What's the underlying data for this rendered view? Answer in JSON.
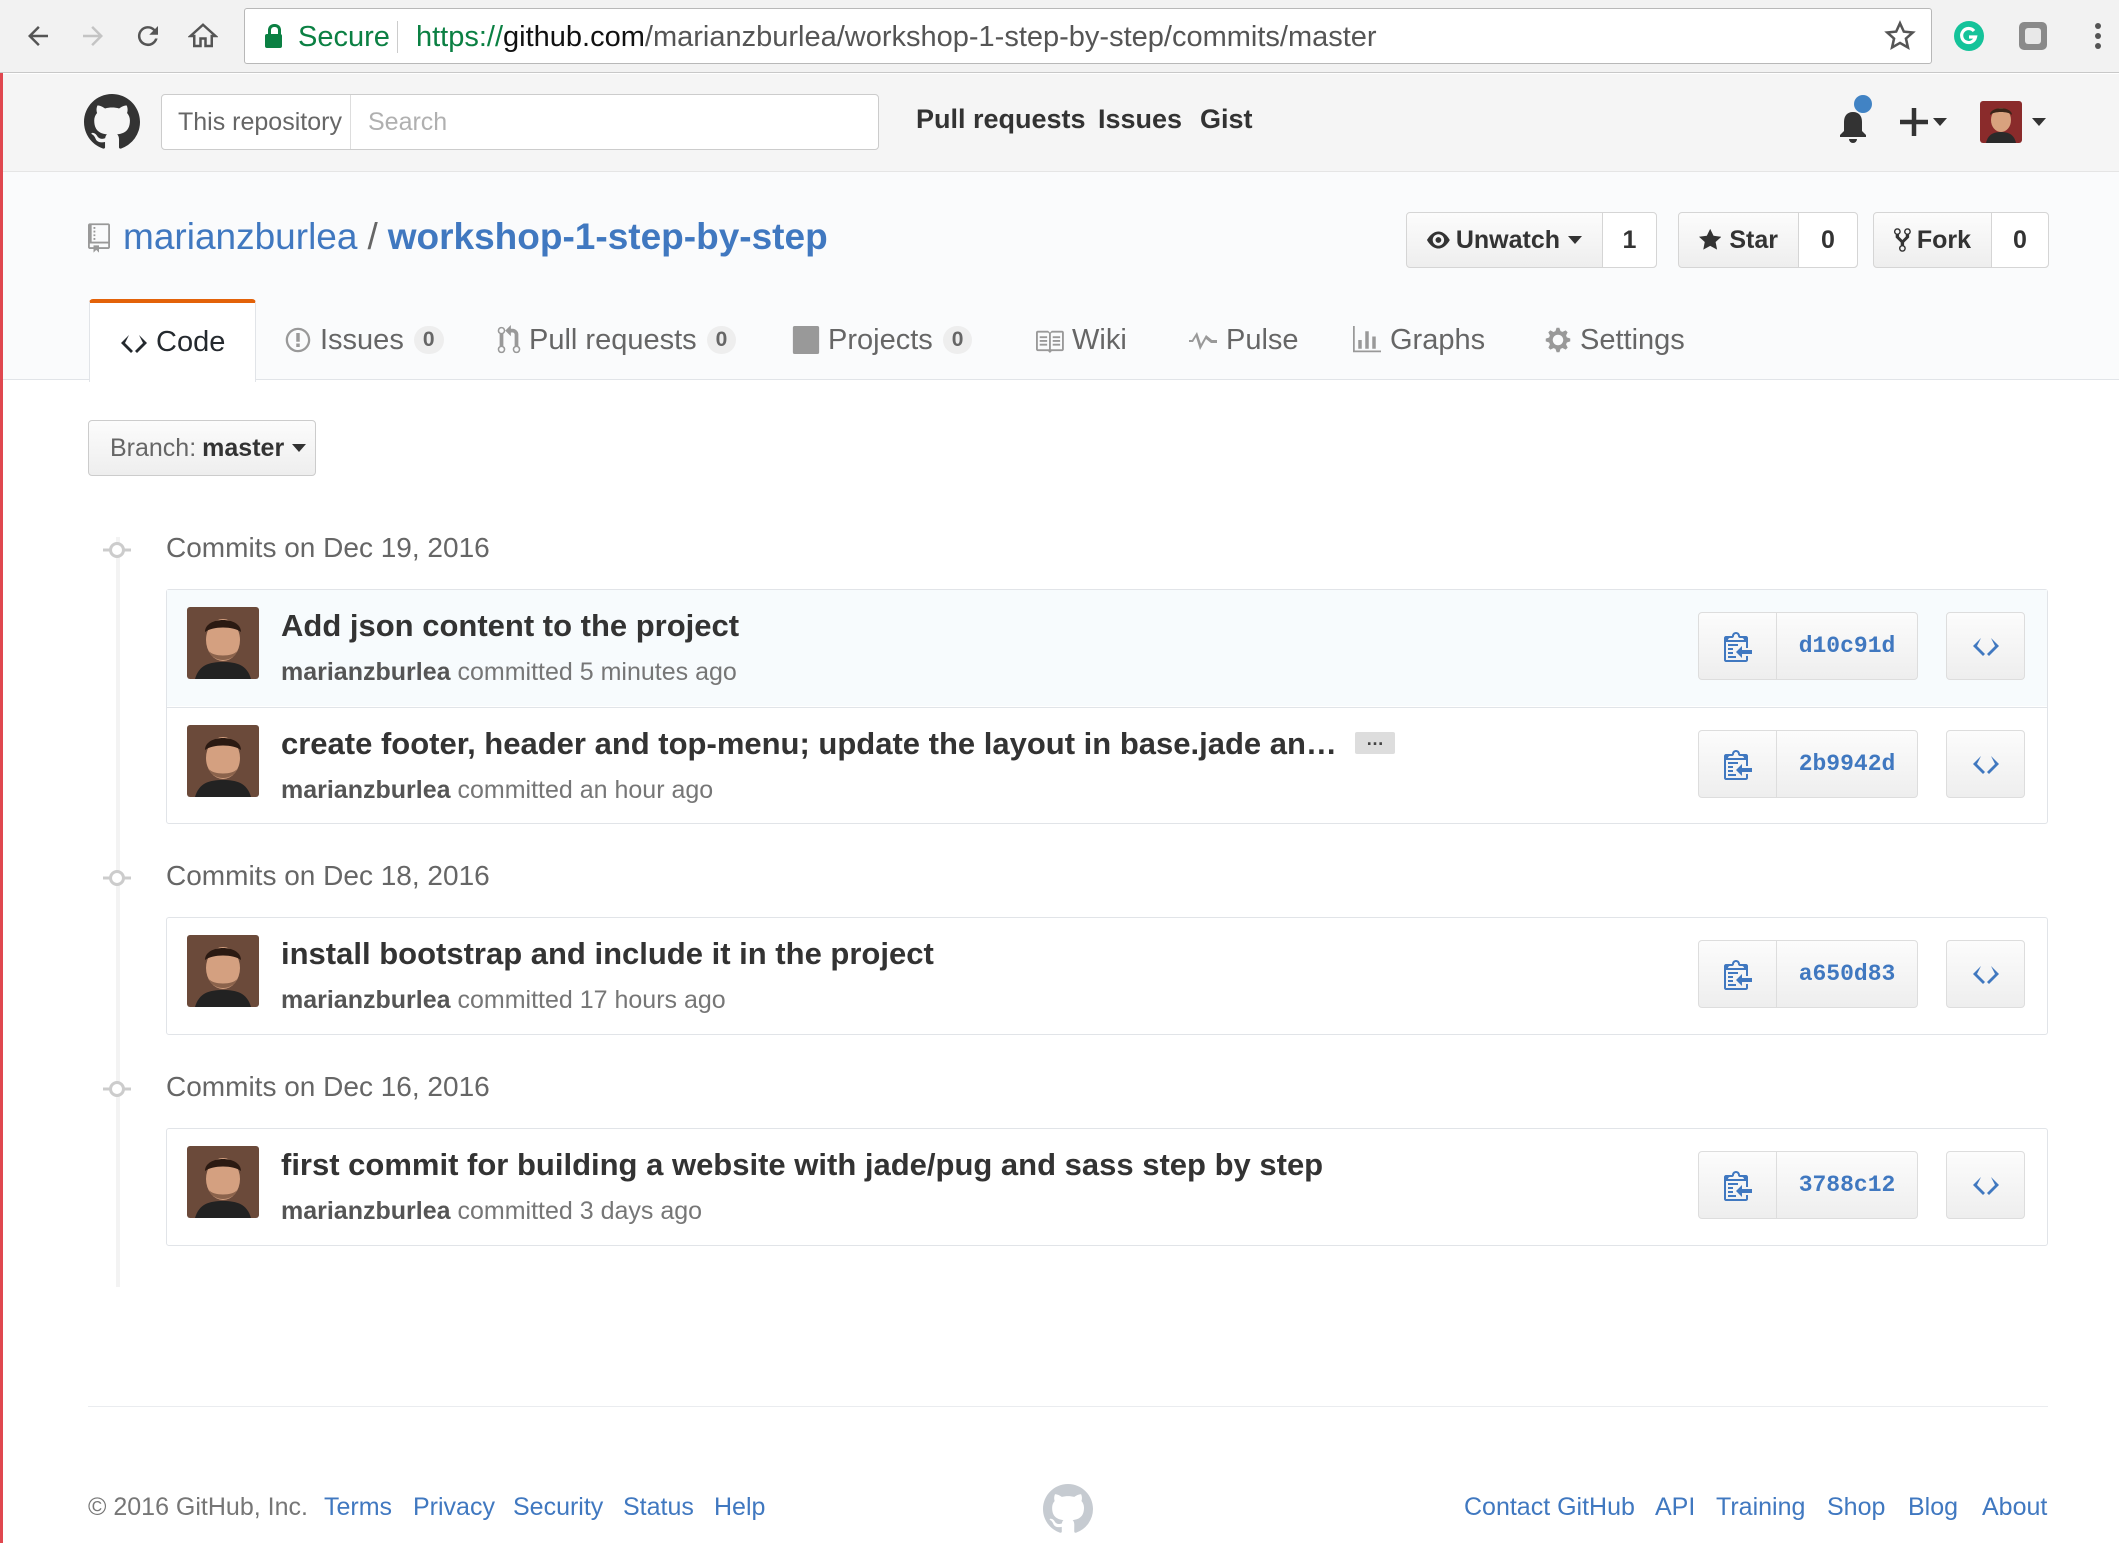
{
  "browser": {
    "secure_label": "Secure",
    "url_protocol": "https://",
    "url_host": "github.com",
    "url_path": "/marianzburlea/workshop-1-step-by-step/commits/master"
  },
  "header": {
    "search_scope": "This repository",
    "search_placeholder": "Search",
    "nav": [
      "Pull requests",
      "Issues",
      "Gist"
    ]
  },
  "repo": {
    "owner": "marianzburlea",
    "separator": "/",
    "name": "workshop-1-step-by-step",
    "watch_label": "Unwatch",
    "watch_count": "1",
    "star_label": "Star",
    "star_count": "0",
    "fork_label": "Fork",
    "fork_count": "0"
  },
  "tabs": [
    {
      "label": "Code"
    },
    {
      "label": "Issues",
      "count": "0"
    },
    {
      "label": "Pull requests",
      "count": "0"
    },
    {
      "label": "Projects",
      "count": "0"
    },
    {
      "label": "Wiki"
    },
    {
      "label": "Pulse"
    },
    {
      "label": "Graphs"
    },
    {
      "label": "Settings"
    }
  ],
  "branch": {
    "prefix": "Branch:",
    "name": "master"
  },
  "days": [
    {
      "title": "Commits on Dec 19, 2016",
      "commits": [
        {
          "message": "Add json content to the project",
          "author": "marianzburlea",
          "verb": "committed",
          "time": "5 minutes ago",
          "sha": "d10c91d"
        },
        {
          "message": "create footer, header and top-menu; update the layout in base.jade an…",
          "ellipsis": "…",
          "author": "marianzburlea",
          "verb": "committed",
          "time": "an hour ago",
          "sha": "2b9942d"
        }
      ]
    },
    {
      "title": "Commits on Dec 18, 2016",
      "commits": [
        {
          "message": "install bootstrap and include it in the project",
          "author": "marianzburlea",
          "verb": "committed",
          "time": "17 hours ago",
          "sha": "a650d83"
        }
      ]
    },
    {
      "title": "Commits on Dec 16, 2016",
      "commits": [
        {
          "message": "first commit for building a website with jade/pug and sass step by step",
          "author": "marianzburlea",
          "verb": "committed",
          "time": "3 days ago",
          "sha": "3788c12"
        }
      ]
    }
  ],
  "footer": {
    "copyright": "© 2016 GitHub, Inc.",
    "left_links": [
      "Terms",
      "Privacy",
      "Security",
      "Status",
      "Help"
    ],
    "right_links": [
      "Contact GitHub",
      "API",
      "Training",
      "Shop",
      "Blog",
      "About"
    ]
  },
  "colors": {
    "link": "#4078c0",
    "secure_green": "#0b8043",
    "active_tab_accent": "#e36209",
    "notification_dot": "#4183c4"
  }
}
